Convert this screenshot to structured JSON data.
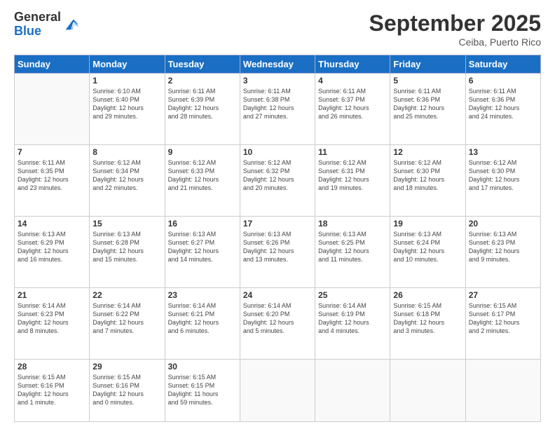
{
  "logo": {
    "general": "General",
    "blue": "Blue"
  },
  "header": {
    "month": "September 2025",
    "location": "Ceiba, Puerto Rico"
  },
  "weekdays": [
    "Sunday",
    "Monday",
    "Tuesday",
    "Wednesday",
    "Thursday",
    "Friday",
    "Saturday"
  ],
  "weeks": [
    [
      {
        "day": "",
        "info": ""
      },
      {
        "day": "1",
        "info": "Sunrise: 6:10 AM\nSunset: 6:40 PM\nDaylight: 12 hours\nand 29 minutes."
      },
      {
        "day": "2",
        "info": "Sunrise: 6:11 AM\nSunset: 6:39 PM\nDaylight: 12 hours\nand 28 minutes."
      },
      {
        "day": "3",
        "info": "Sunrise: 6:11 AM\nSunset: 6:38 PM\nDaylight: 12 hours\nand 27 minutes."
      },
      {
        "day": "4",
        "info": "Sunrise: 6:11 AM\nSunset: 6:37 PM\nDaylight: 12 hours\nand 26 minutes."
      },
      {
        "day": "5",
        "info": "Sunrise: 6:11 AM\nSunset: 6:36 PM\nDaylight: 12 hours\nand 25 minutes."
      },
      {
        "day": "6",
        "info": "Sunrise: 6:11 AM\nSunset: 6:36 PM\nDaylight: 12 hours\nand 24 minutes."
      }
    ],
    [
      {
        "day": "7",
        "info": "Sunrise: 6:11 AM\nSunset: 6:35 PM\nDaylight: 12 hours\nand 23 minutes."
      },
      {
        "day": "8",
        "info": "Sunrise: 6:12 AM\nSunset: 6:34 PM\nDaylight: 12 hours\nand 22 minutes."
      },
      {
        "day": "9",
        "info": "Sunrise: 6:12 AM\nSunset: 6:33 PM\nDaylight: 12 hours\nand 21 minutes."
      },
      {
        "day": "10",
        "info": "Sunrise: 6:12 AM\nSunset: 6:32 PM\nDaylight: 12 hours\nand 20 minutes."
      },
      {
        "day": "11",
        "info": "Sunrise: 6:12 AM\nSunset: 6:31 PM\nDaylight: 12 hours\nand 19 minutes."
      },
      {
        "day": "12",
        "info": "Sunrise: 6:12 AM\nSunset: 6:30 PM\nDaylight: 12 hours\nand 18 minutes."
      },
      {
        "day": "13",
        "info": "Sunrise: 6:12 AM\nSunset: 6:30 PM\nDaylight: 12 hours\nand 17 minutes."
      }
    ],
    [
      {
        "day": "14",
        "info": "Sunrise: 6:13 AM\nSunset: 6:29 PM\nDaylight: 12 hours\nand 16 minutes."
      },
      {
        "day": "15",
        "info": "Sunrise: 6:13 AM\nSunset: 6:28 PM\nDaylight: 12 hours\nand 15 minutes."
      },
      {
        "day": "16",
        "info": "Sunrise: 6:13 AM\nSunset: 6:27 PM\nDaylight: 12 hours\nand 14 minutes."
      },
      {
        "day": "17",
        "info": "Sunrise: 6:13 AM\nSunset: 6:26 PM\nDaylight: 12 hours\nand 13 minutes."
      },
      {
        "day": "18",
        "info": "Sunrise: 6:13 AM\nSunset: 6:25 PM\nDaylight: 12 hours\nand 11 minutes."
      },
      {
        "day": "19",
        "info": "Sunrise: 6:13 AM\nSunset: 6:24 PM\nDaylight: 12 hours\nand 10 minutes."
      },
      {
        "day": "20",
        "info": "Sunrise: 6:13 AM\nSunset: 6:23 PM\nDaylight: 12 hours\nand 9 minutes."
      }
    ],
    [
      {
        "day": "21",
        "info": "Sunrise: 6:14 AM\nSunset: 6:23 PM\nDaylight: 12 hours\nand 8 minutes."
      },
      {
        "day": "22",
        "info": "Sunrise: 6:14 AM\nSunset: 6:22 PM\nDaylight: 12 hours\nand 7 minutes."
      },
      {
        "day": "23",
        "info": "Sunrise: 6:14 AM\nSunset: 6:21 PM\nDaylight: 12 hours\nand 6 minutes."
      },
      {
        "day": "24",
        "info": "Sunrise: 6:14 AM\nSunset: 6:20 PM\nDaylight: 12 hours\nand 5 minutes."
      },
      {
        "day": "25",
        "info": "Sunrise: 6:14 AM\nSunset: 6:19 PM\nDaylight: 12 hours\nand 4 minutes."
      },
      {
        "day": "26",
        "info": "Sunrise: 6:15 AM\nSunset: 6:18 PM\nDaylight: 12 hours\nand 3 minutes."
      },
      {
        "day": "27",
        "info": "Sunrise: 6:15 AM\nSunset: 6:17 PM\nDaylight: 12 hours\nand 2 minutes."
      }
    ],
    [
      {
        "day": "28",
        "info": "Sunrise: 6:15 AM\nSunset: 6:16 PM\nDaylight: 12 hours\nand 1 minute."
      },
      {
        "day": "29",
        "info": "Sunrise: 6:15 AM\nSunset: 6:16 PM\nDaylight: 12 hours\nand 0 minutes."
      },
      {
        "day": "30",
        "info": "Sunrise: 6:15 AM\nSunset: 6:15 PM\nDaylight: 11 hours\nand 59 minutes."
      },
      {
        "day": "",
        "info": ""
      },
      {
        "day": "",
        "info": ""
      },
      {
        "day": "",
        "info": ""
      },
      {
        "day": "",
        "info": ""
      }
    ]
  ]
}
